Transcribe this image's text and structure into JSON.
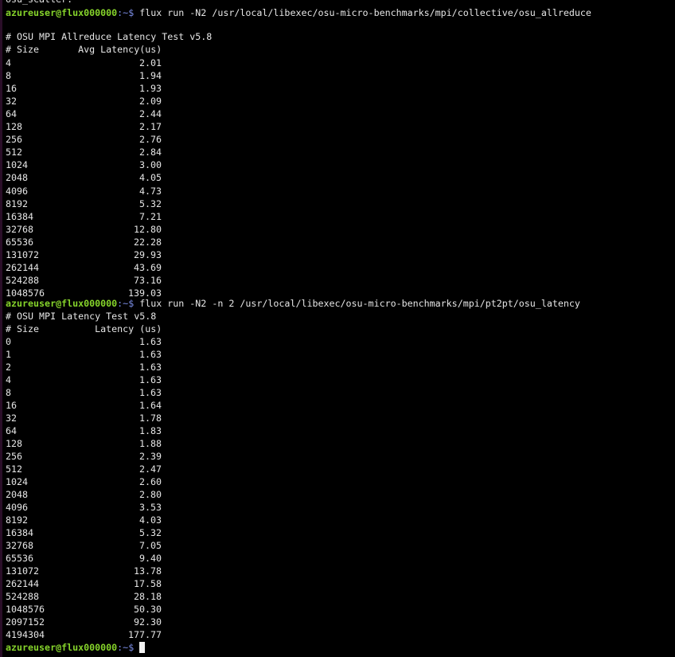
{
  "terminal": {
    "partial_top_line": "osu_scatter:",
    "prompt": {
      "user_host": "azureuser@flux000000",
      "path": ":~$ "
    },
    "commands": [
      "flux run -N2 /usr/local/libexec/osu-micro-benchmarks/mpi/collective/osu_allreduce",
      "flux run -N2 -n 2 /usr/local/libexec/osu-micro-benchmarks/mpi/pt2pt/osu_latency"
    ],
    "allreduce": {
      "title": "# OSU MPI Allreduce Latency Test v5.8",
      "header": "# Size       Avg Latency(us)",
      "rows": [
        [
          "4",
          "2.01"
        ],
        [
          "8",
          "1.94"
        ],
        [
          "16",
          "1.93"
        ],
        [
          "32",
          "2.09"
        ],
        [
          "64",
          "2.44"
        ],
        [
          "128",
          "2.17"
        ],
        [
          "256",
          "2.76"
        ],
        [
          "512",
          "2.84"
        ],
        [
          "1024",
          "3.00"
        ],
        [
          "2048",
          "4.05"
        ],
        [
          "4096",
          "4.73"
        ],
        [
          "8192",
          "5.32"
        ],
        [
          "16384",
          "7.21"
        ],
        [
          "32768",
          "12.80"
        ],
        [
          "65536",
          "22.28"
        ],
        [
          "131072",
          "29.93"
        ],
        [
          "262144",
          "43.69"
        ],
        [
          "524288",
          "73.16"
        ],
        [
          "1048576",
          "139.03"
        ]
      ]
    },
    "latency": {
      "title": "# OSU MPI Latency Test v5.8",
      "header": "# Size          Latency (us)",
      "rows": [
        [
          "0",
          "1.63"
        ],
        [
          "1",
          "1.63"
        ],
        [
          "2",
          "1.63"
        ],
        [
          "4",
          "1.63"
        ],
        [
          "8",
          "1.63"
        ],
        [
          "16",
          "1.64"
        ],
        [
          "32",
          "1.78"
        ],
        [
          "64",
          "1.83"
        ],
        [
          "128",
          "1.88"
        ],
        [
          "256",
          "2.39"
        ],
        [
          "512",
          "2.47"
        ],
        [
          "1024",
          "2.60"
        ],
        [
          "2048",
          "2.80"
        ],
        [
          "4096",
          "3.53"
        ],
        [
          "8192",
          "4.03"
        ],
        [
          "16384",
          "5.32"
        ],
        [
          "32768",
          "7.05"
        ],
        [
          "65536",
          "9.40"
        ],
        [
          "131072",
          "13.78"
        ],
        [
          "262144",
          "17.58"
        ],
        [
          "524288",
          "28.18"
        ],
        [
          "1048576",
          "50.30"
        ],
        [
          "2097152",
          "92.30"
        ],
        [
          "4194304",
          "177.77"
        ]
      ]
    }
  }
}
